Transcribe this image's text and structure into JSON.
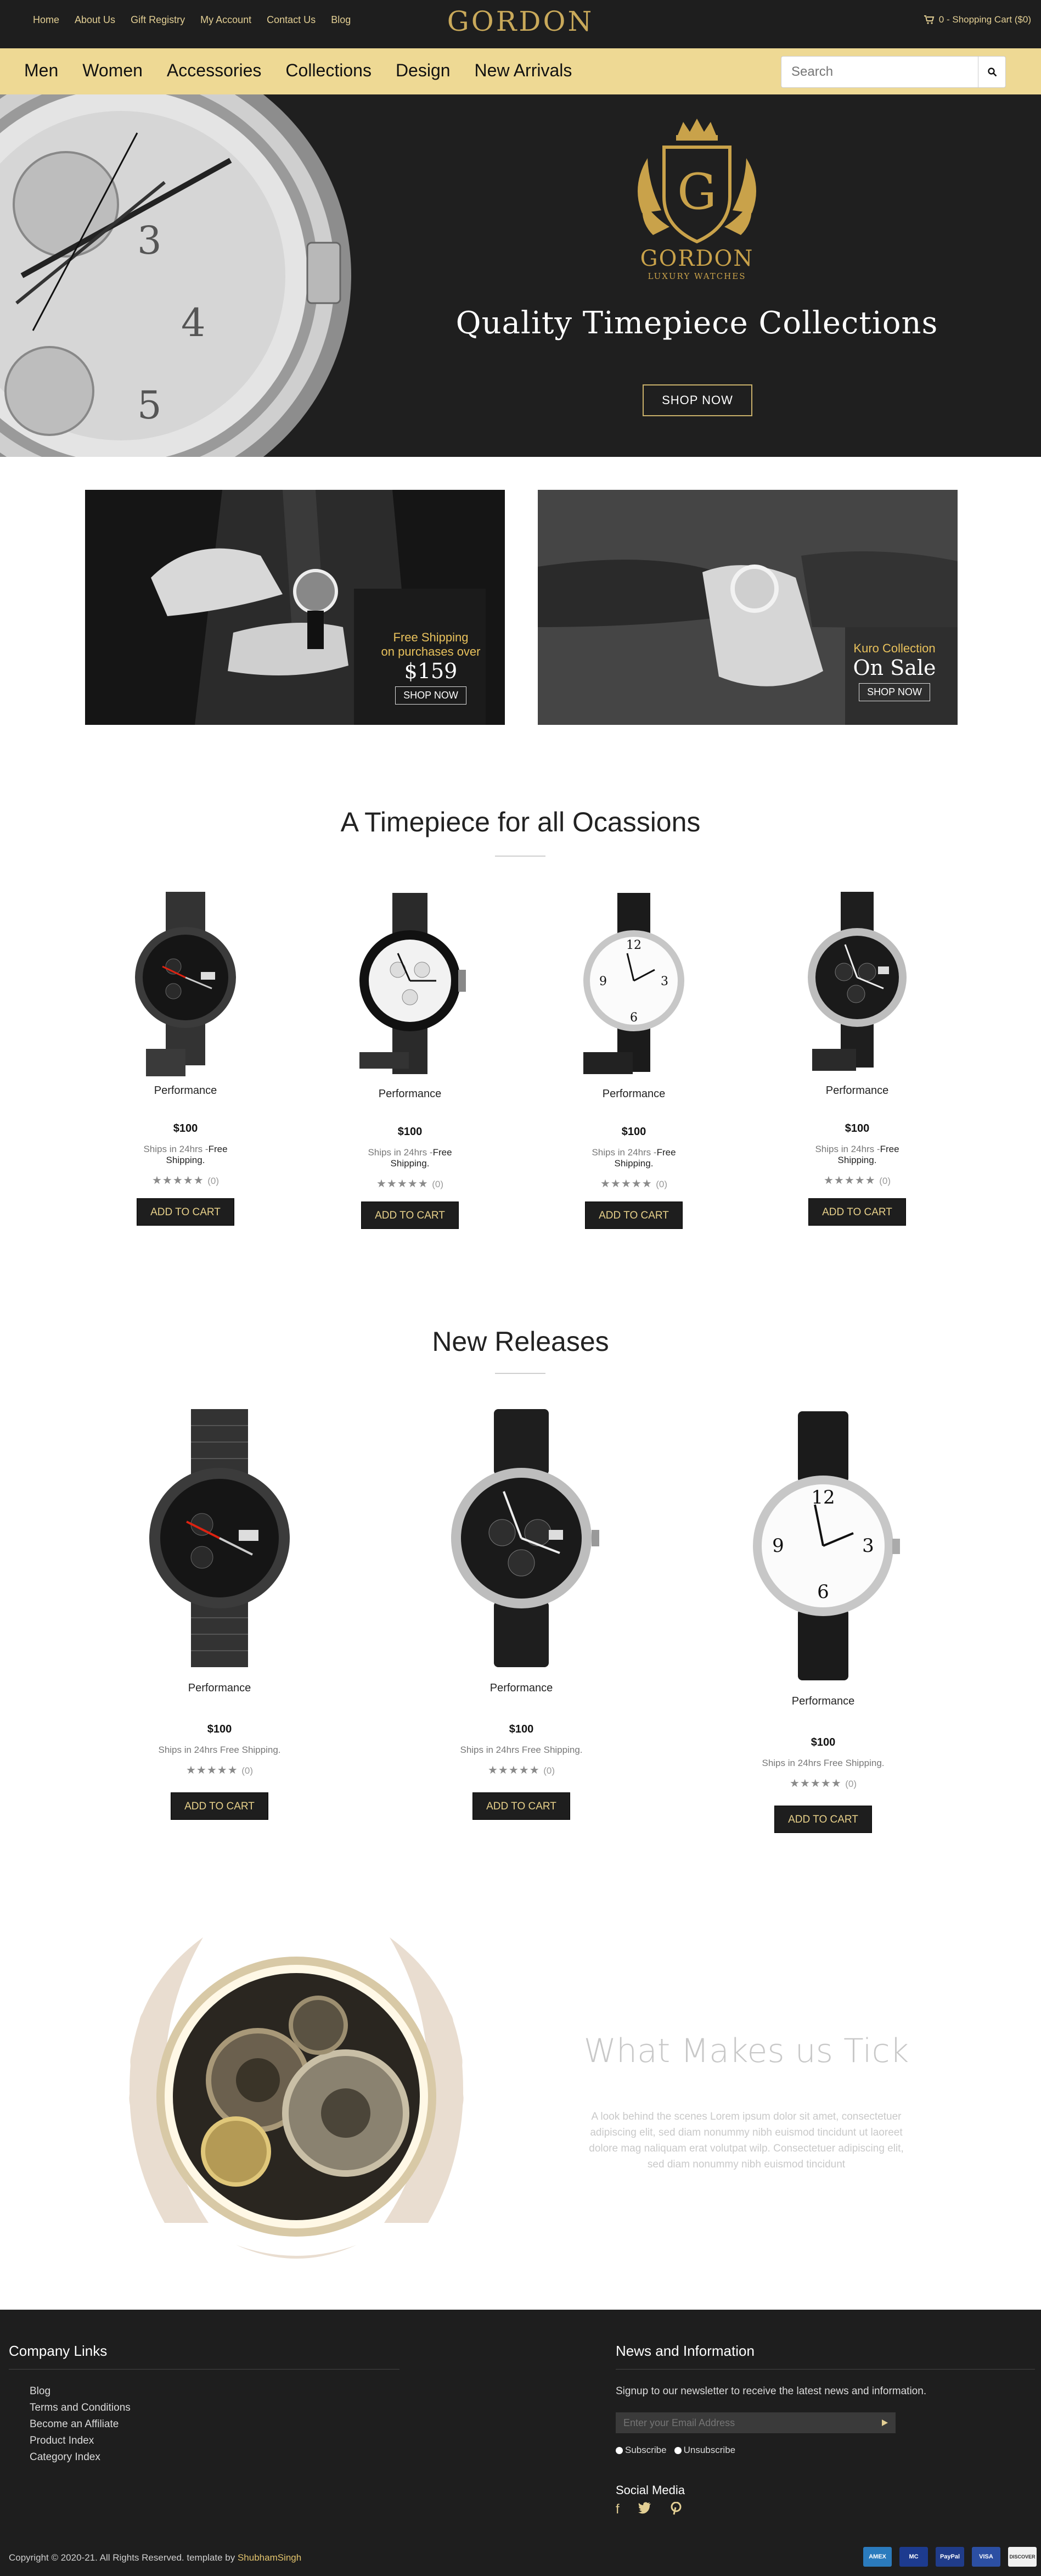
{
  "topbar": {
    "links": [
      "Home",
      "About Us",
      "Gift Registry",
      "My Account",
      "Contact Us",
      "Blog"
    ],
    "logo": "GORDON",
    "cart": "0 - Shopping Cart ($0)"
  },
  "nav": {
    "items": [
      "Men",
      "Women",
      "Accessories",
      "Collections",
      "Design",
      "New Arrivals"
    ],
    "search_placeholder": "Search"
  },
  "hero": {
    "emblem_brand": "GORDON",
    "emblem_sub": "LUXURY WATCHES",
    "headline": "Quality Timepiece Collections",
    "button": "SHOP NOW"
  },
  "promos": [
    {
      "line1": "Free Shipping",
      "line2": "on purchases over",
      "big": "$159",
      "button": "SHOP NOW"
    },
    {
      "line1": "Kuro Collection",
      "big": "On Sale",
      "button": "SHOP NOW"
    }
  ],
  "occasions": {
    "title": "A Timepiece for all Ocassions",
    "products": [
      {
        "name": "Performance",
        "price": "$100",
        "ship": "Ships in 24hrs -",
        "ship_bold": "Free Shipping.",
        "stars": "★★★★★",
        "count": "(0)",
        "button": "ADD TO CART"
      },
      {
        "name": "Performance",
        "price": "$100",
        "ship": "Ships in 24hrs -",
        "ship_bold": "Free Shipping.",
        "stars": "★★★★★",
        "count": "(0)",
        "button": "ADD TO CART"
      },
      {
        "name": "Performance",
        "price": "$100",
        "ship": "Ships in 24hrs -",
        "ship_bold": "Free Shipping.",
        "stars": "★★★★★",
        "count": "(0)",
        "button": "ADD TO CART"
      },
      {
        "name": "Performance",
        "price": "$100",
        "ship": "Ships in 24hrs -",
        "ship_bold": "Free Shipping.",
        "stars": "★★★★★",
        "count": "(0)",
        "button": "ADD TO CART"
      }
    ]
  },
  "releases": {
    "title": "New Releases",
    "products": [
      {
        "name": "Performance",
        "price": "$100",
        "ship": "Ships in 24hrs Free Shipping.",
        "stars": "★★★★★",
        "count": "(0)",
        "button": "ADD TO CART"
      },
      {
        "name": "Performance",
        "price": "$100",
        "ship": "Ships in 24hrs Free Shipping.",
        "stars": "★★★★★",
        "count": "(0)",
        "button": "ADD TO CART"
      },
      {
        "name": "Performance",
        "price": "$100",
        "ship": "Ships in 24hrs Free Shipping.",
        "stars": "★★★★★",
        "count": "(0)",
        "button": "ADD TO CART"
      }
    ]
  },
  "tick": {
    "title": "What Makes us Tick",
    "text": "A look behind the scenes Lorem ipsum dolor sit amet, consectetuer adipiscing elit, sed diam nonummy nibh euismod tincidunt ut laoreet dolore mag naliquam erat volutpat wilp. Consectetuer adipiscing elit, sed diam nonummy nibh euismod tincidunt"
  },
  "footer": {
    "company_title": "Company Links",
    "company_links": [
      "Blog",
      "Terms and Conditions",
      "Become an Affiliate",
      "Product Index",
      "Category Index"
    ],
    "news_title": "News and Information",
    "news_text": "Signup to our newsletter to receive the latest news and information.",
    "email_placeholder": "Enter your Email Address",
    "subscribe": "Subscribe",
    "unsubscribe": "Unsubscribe",
    "social_title": "Social Media",
    "social_icons": [
      "facebook-icon",
      "twitter-icon",
      "pinterest-icon"
    ],
    "copyright": "Copyright © 2020-21. All Rights Reserved. template by",
    "author": "ShubhamSingh",
    "payments": [
      "AMEX",
      "MC",
      "PayPal",
      "VISA",
      "DISCOVER"
    ]
  },
  "colors": {
    "dark": "#1e1e1e",
    "gold": "#eed994",
    "gold_text": "#e3cf94"
  }
}
